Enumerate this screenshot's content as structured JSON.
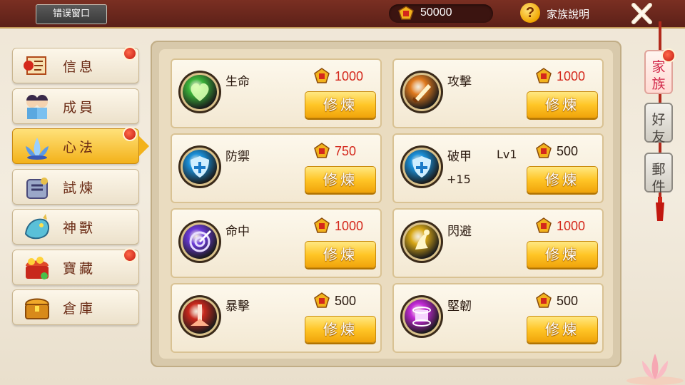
{
  "header": {
    "title_ghost": "家族",
    "error_window_label": "错误窗口",
    "currency_amount": "50000",
    "help_label": "家族說明"
  },
  "menu": {
    "items": [
      {
        "label": "信息",
        "icon": "scroll-icon",
        "dot": true
      },
      {
        "label": "成員",
        "icon": "members-icon",
        "dot": false
      },
      {
        "label": "心法",
        "icon": "lotus-icon",
        "dot": true,
        "active": true
      },
      {
        "label": "試煉",
        "icon": "trial-icon",
        "dot": false
      },
      {
        "label": "神獸",
        "icon": "beast-icon",
        "dot": false
      },
      {
        "label": "寶藏",
        "icon": "treasure-icon",
        "dot": true
      },
      {
        "label": "倉庫",
        "icon": "chest-icon",
        "dot": false
      }
    ]
  },
  "skills": [
    {
      "name": "生命",
      "cost": "1000",
      "cost_color": "#d4281c",
      "button": "修煉",
      "icon": "heart-orb-icon",
      "orb_color": "#3cb43a"
    },
    {
      "name": "攻擊",
      "cost": "1000",
      "cost_color": "#d4281c",
      "button": "修煉",
      "icon": "sword-orb-icon",
      "orb_color": "#e07a1e"
    },
    {
      "name": "防禦",
      "cost": "750",
      "cost_color": "#d4281c",
      "button": "修煉",
      "icon": "shield-orb-icon",
      "orb_color": "#1a8fd8"
    },
    {
      "name": "破甲",
      "level": "Lv1",
      "bonus": "+15",
      "cost": "500",
      "cost_color": "#2b1a10",
      "button": "修煉",
      "icon": "shield-orb-icon",
      "orb_color": "#1a8fd8"
    },
    {
      "name": "命中",
      "cost": "1000",
      "cost_color": "#d4281c",
      "button": "修煉",
      "icon": "target-orb-icon",
      "orb_color": "#6a3ad8"
    },
    {
      "name": "閃避",
      "cost": "1000",
      "cost_color": "#d4281c",
      "button": "修煉",
      "icon": "dodge-orb-icon",
      "orb_color": "#d8a818"
    },
    {
      "name": "暴擊",
      "cost": "500",
      "cost_color": "#2b1a10",
      "button": "修煉",
      "icon": "crit-orb-icon",
      "orb_color": "#c8281c"
    },
    {
      "name": "堅韌",
      "cost": "500",
      "cost_color": "#2b1a10",
      "button": "修煉",
      "icon": "tough-orb-icon",
      "orb_color": "#c42ad8"
    }
  ],
  "side_tabs": [
    {
      "label_top": "家",
      "label_bottom": "族",
      "active": true
    },
    {
      "label_top": "好",
      "label_bottom": "友",
      "active": false
    },
    {
      "label_top": "郵",
      "label_bottom": "件",
      "active": false
    }
  ],
  "colors": {
    "topbar": "#6a261c",
    "button_gold": "#ffc627",
    "active_menu": "#f3b21a"
  }
}
